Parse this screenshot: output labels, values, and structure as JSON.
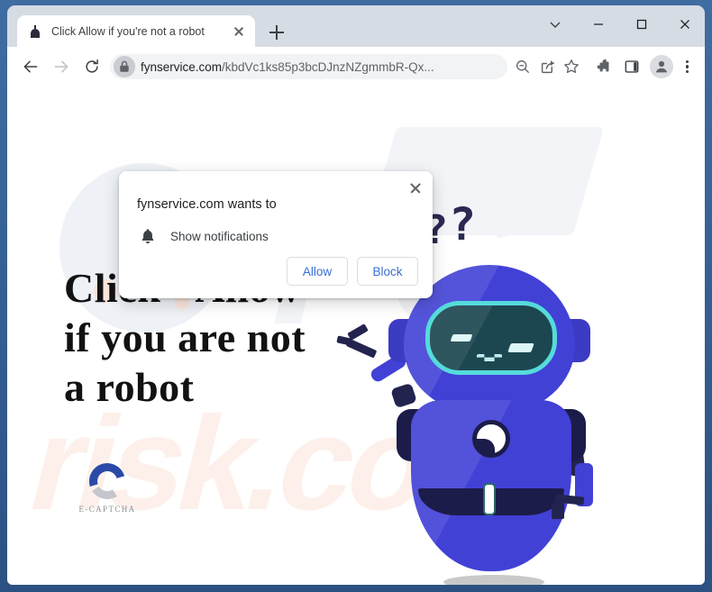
{
  "browser": {
    "tab": {
      "title": "Click Allow if you're not a robot",
      "favicon": "robot-favicon",
      "close_label": "",
      "new_tab_label": ""
    },
    "window_controls": {
      "tab_search": "chevron-down-icon",
      "minimize": "minimize-icon",
      "maximize": "maximize-icon",
      "close": "close-icon"
    },
    "toolbar": {
      "back": "back-arrow-icon",
      "forward": "forward-arrow-icon",
      "reload": "reload-icon",
      "site_lock": "lock-icon",
      "url_host": "fynservice.com",
      "url_path": "/kbdVc1ks85p3bcDJnzNZgmmbR-Qx...",
      "url_full": "fynservice.com/kbdVc1ks85p3bcDJnzNZgmmbR-Qx...",
      "zoom_out": "zoom-out-icon",
      "share": "share-icon",
      "bookmark": "bookmark-star-icon",
      "extensions": "puzzle-piece-icon",
      "side_panel": "side-panel-icon",
      "profile": "profile-avatar-icon",
      "menu": "three-dot-menu-icon"
    }
  },
  "notification_dialog": {
    "title": "fynservice.com wants to",
    "permission_icon": "bell-icon",
    "permission_label": "Show notifications",
    "allow_label": "Allow",
    "block_label": "Block",
    "close_label": "×"
  },
  "page": {
    "headline": "Click \"Allow\"\nif you are not\na robot",
    "captcha_logo_label": "E-CAPTCHA",
    "robot": {
      "thought_1": "?",
      "thought_2": "?"
    },
    "watermarks": {
      "top": "PC",
      "bottom": "risk.com"
    }
  },
  "colors": {
    "window_frame": "#2b5182",
    "tabstrip": "#d6dce4",
    "toolbar": "#ffffff",
    "omnibox": "#f1f3f4",
    "dialog_button_text": "#3b6fd4",
    "robot_blue": "#4141d6",
    "robot_navy": "#1c1c4a",
    "visor_teal": "#55dbdb",
    "visor_dark": "#1d4750",
    "headline_text": "#121212",
    "watermark_gray": "#f2f4f7",
    "watermark_peach": "#fdf0ea"
  }
}
